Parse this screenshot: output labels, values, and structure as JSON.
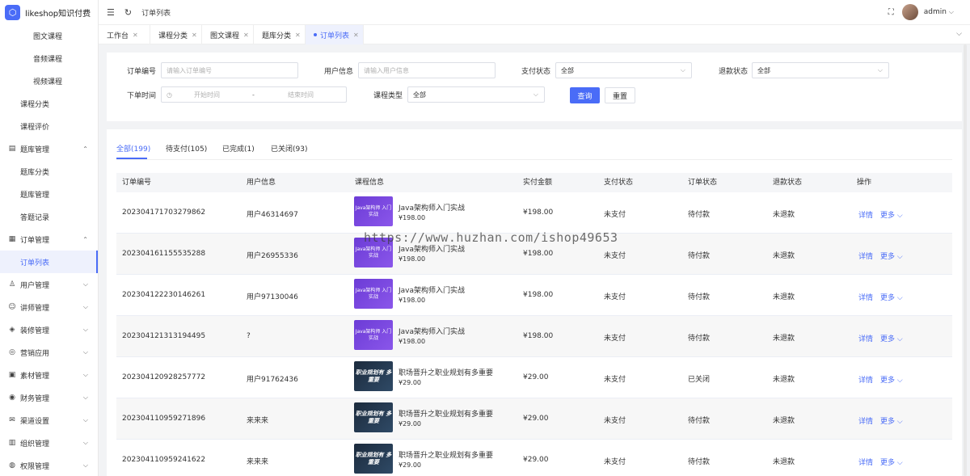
{
  "app": {
    "title": "likeshop知识付费",
    "logo_glyph": "⬡"
  },
  "sidebar": {
    "items": [
      {
        "label": "图文课程",
        "level": 2
      },
      {
        "label": "音频课程",
        "level": 2
      },
      {
        "label": "视频课程",
        "level": 2
      },
      {
        "label": "课程分类",
        "level": 1
      },
      {
        "label": "课程评价",
        "level": 1
      },
      {
        "label": "题库管理",
        "level": 0,
        "icon": "book-icon"
      },
      {
        "label": "题库分类",
        "level": 1
      },
      {
        "label": "题库管理",
        "level": 1
      },
      {
        "label": "答题记录",
        "level": 1
      },
      {
        "label": "订单管理",
        "level": 0,
        "icon": "order-icon"
      },
      {
        "label": "订单列表",
        "level": 1,
        "active": true
      },
      {
        "label": "用户管理",
        "level": 0,
        "icon": "user-icon"
      },
      {
        "label": "讲师管理",
        "level": 0,
        "icon": "teacher-icon"
      },
      {
        "label": "装修管理",
        "level": 0,
        "icon": "decorate-icon"
      },
      {
        "label": "营销应用",
        "level": 0,
        "icon": "marketing-icon"
      },
      {
        "label": "素材管理",
        "level": 0,
        "icon": "material-icon"
      },
      {
        "label": "财务管理",
        "level": 0,
        "icon": "finance-icon"
      },
      {
        "label": "渠道设置",
        "level": 0,
        "icon": "channel-icon"
      },
      {
        "label": "组织管理",
        "level": 0,
        "icon": "org-icon"
      },
      {
        "label": "权限管理",
        "level": 0,
        "icon": "permission-icon"
      }
    ]
  },
  "header": {
    "breadcrumb": "订单列表",
    "username": "admin"
  },
  "tabs": [
    {
      "label": "工作台"
    },
    {
      "label": "课程分类"
    },
    {
      "label": "图文课程"
    },
    {
      "label": "题库分类"
    },
    {
      "label": "订单列表",
      "active": true
    }
  ],
  "filters": {
    "order_no": {
      "label": "订单编号",
      "placeholder": "请输入订单编号"
    },
    "user_info": {
      "label": "用户信息",
      "placeholder": "请输入用户信息"
    },
    "pay_status": {
      "label": "支付状态",
      "value": "全部"
    },
    "refund_status": {
      "label": "退款状态",
      "value": "全部"
    },
    "order_time": {
      "label": "下单时间",
      "start_placeholder": "开始时间",
      "separator": "-",
      "end_placeholder": "结束时间"
    },
    "course_type": {
      "label": "课程类型",
      "value": "全部"
    },
    "query_button": "查询",
    "reset_button": "重置"
  },
  "status_tabs": [
    {
      "label": "全部(199)",
      "active": true
    },
    {
      "label": "待支付(105)"
    },
    {
      "label": "已完成(1)"
    },
    {
      "label": "已关闭(93)"
    }
  ],
  "table": {
    "columns": [
      "订单编号",
      "用户信息",
      "课程信息",
      "实付金额",
      "支付状态",
      "订单状态",
      "退款状态",
      "操作"
    ],
    "rows": [
      {
        "order_no": "202304171703279862",
        "user": "用户46314697",
        "thumb": "java",
        "course": "Java架构师入门实战",
        "price": "¥198.00",
        "paid": "¥198.00",
        "pay_status": "未支付",
        "order_status": "待付款",
        "refund_status": "未退款"
      },
      {
        "order_no": "202304161155535288",
        "user": "用户26955336",
        "thumb": "java",
        "course": "Java架构师入门实战",
        "price": "¥198.00",
        "paid": "¥198.00",
        "pay_status": "未支付",
        "order_status": "待付款",
        "refund_status": "未退款"
      },
      {
        "order_no": "202304122230146261",
        "user": "用户97130046",
        "thumb": "java",
        "course": "Java架构师入门实战",
        "price": "¥198.00",
        "paid": "¥198.00",
        "pay_status": "未支付",
        "order_status": "待付款",
        "refund_status": "未退款"
      },
      {
        "order_no": "202304121313194495",
        "user": "?",
        "thumb": "java",
        "course": "Java架构师入门实战",
        "price": "¥198.00",
        "paid": "¥198.00",
        "pay_status": "未支付",
        "order_status": "待付款",
        "refund_status": "未退款"
      },
      {
        "order_no": "202304120928257772",
        "user": "用户91762436",
        "thumb": "career",
        "course": "职场晋升之职业规划有多重要",
        "price": "¥29.00",
        "paid": "¥29.00",
        "pay_status": "未支付",
        "order_status": "已关闭",
        "refund_status": "未退款"
      },
      {
        "order_no": "202304110959271896",
        "user": "来来来",
        "thumb": "career",
        "course": "职场晋升之职业规划有多重要",
        "price": "¥29.00",
        "paid": "¥29.00",
        "pay_status": "未支付",
        "order_status": "待付款",
        "refund_status": "未退款"
      },
      {
        "order_no": "202304110959241622",
        "user": "来来来",
        "thumb": "career",
        "course": "职场晋升之职业规划有多重要",
        "price": "¥29.00",
        "paid": "¥29.00",
        "pay_status": "未支付",
        "order_status": "待付款",
        "refund_status": "未退款"
      }
    ],
    "action_detail": "详情",
    "action_more": "更多"
  },
  "thumbs": {
    "java": "Java架构师 入门实战",
    "career": "职业规划有 多重要"
  },
  "watermark": "https://www.huzhan.com/ishop49653",
  "colors": {
    "accent": "#4a6cf7"
  }
}
